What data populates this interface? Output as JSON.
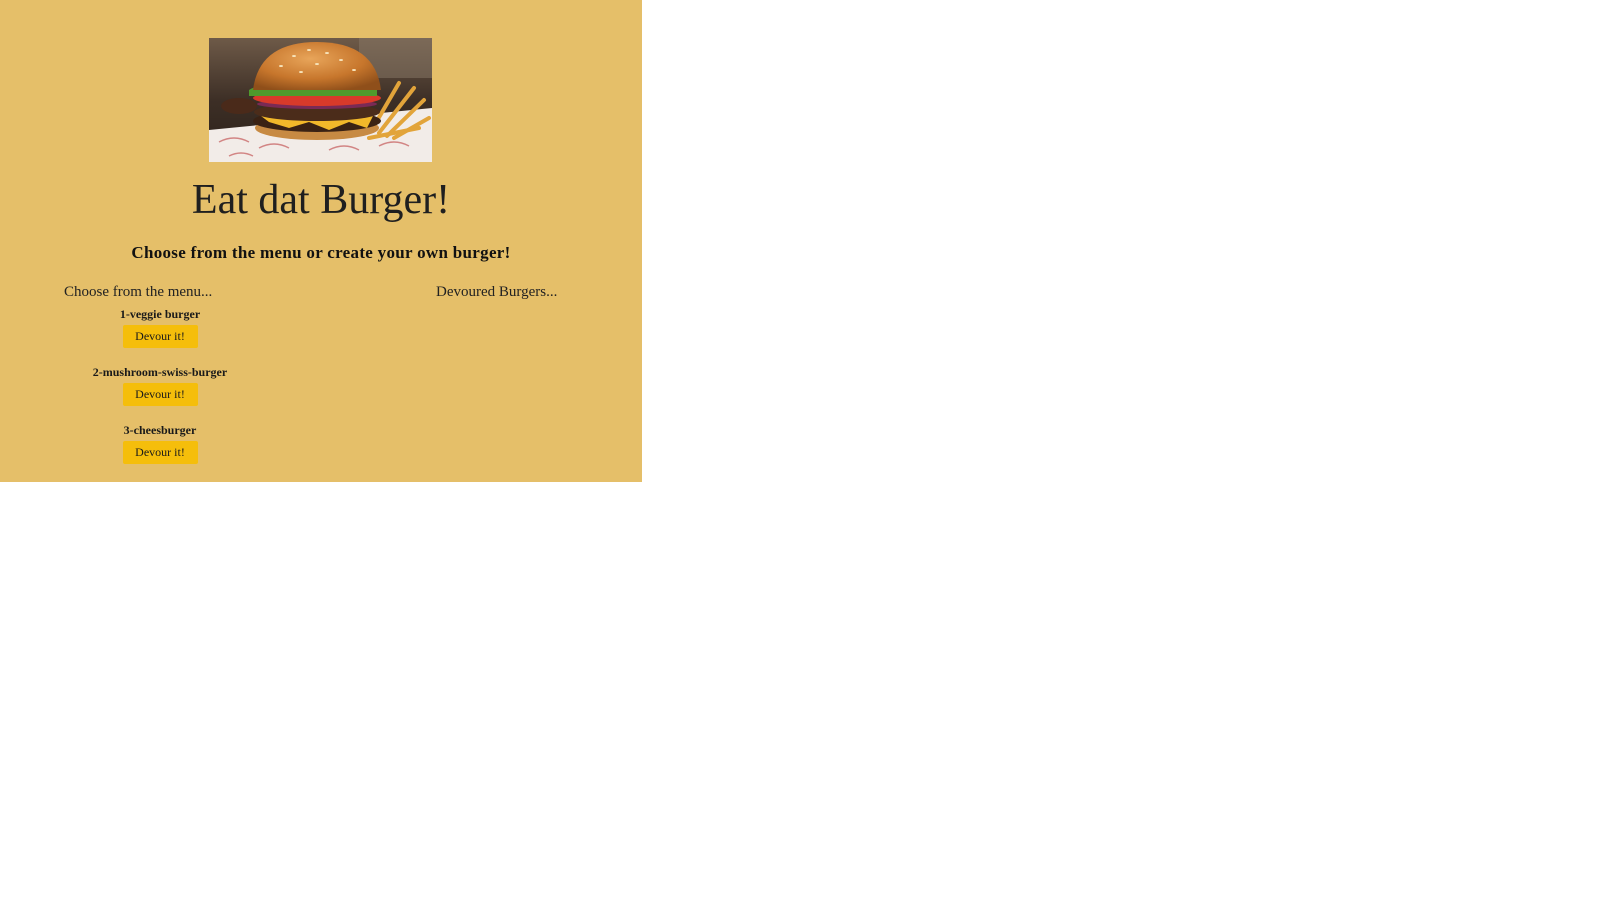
{
  "header": {
    "title": "Eat dat Burger!",
    "subtitle": "Choose from the menu or create your own burger!"
  },
  "columns": {
    "menu_heading": "Choose from the menu...",
    "devoured_heading": "Devoured Burgers..."
  },
  "menu": {
    "items": [
      {
        "name": "1-veggie burger",
        "button_label": "Devour it!"
      },
      {
        "name": "2-mushroom-swiss-burger",
        "button_label": "Devour it!"
      },
      {
        "name": "3-cheesburger",
        "button_label": "Devour it!"
      }
    ]
  },
  "devoured": {
    "items": []
  },
  "colors": {
    "panel_background": "#e5bf69",
    "button_background": "#f5be0b",
    "page_background": "#ffffff"
  },
  "hero_image": {
    "icon": "burger-photo"
  }
}
